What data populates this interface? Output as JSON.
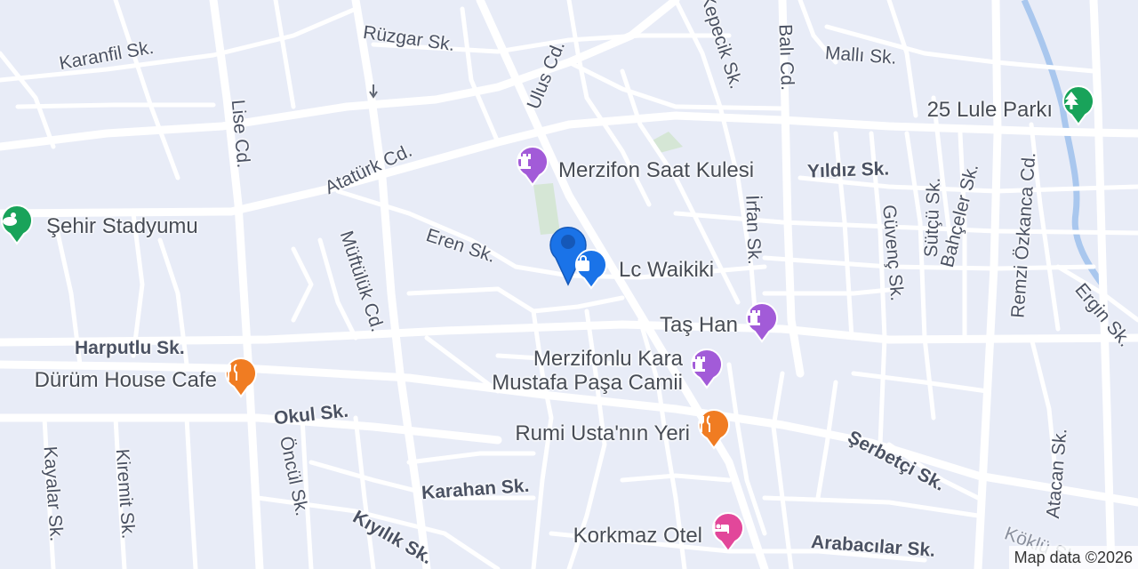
{
  "map": {
    "colors": {
      "background": "#e8ecf7",
      "road": "#ffffff",
      "park": "#d5e6d5",
      "water": "#a9c7ee",
      "landmark_pin": "#a25bd8",
      "restaurant_pin": "#f07c22",
      "shop_pin": "#1a73e8",
      "hotel_pin": "#e2479a",
      "park_pin": "#19a35a",
      "stadium_pin": "#19a35a",
      "location_marker": "#1a73e8"
    },
    "streets": {
      "karanfil": "Karanfil Sk.",
      "ruzgar": "Rüzgar Sk.",
      "ulus": "Ulus Cd.",
      "kepecik": "Kepecik Sk.",
      "bali": "Balı Cd.",
      "malli": "Mallı Sk.",
      "lise": "Lise Cd.",
      "ataturk": "Atatürk Cd.",
      "yildiz": "Yıldız Sk.",
      "irfan": "İrfan Sk.",
      "guvenc": "Güvenç Sk.",
      "sutcu": "Sütçü Sk.",
      "bahceler": "Bahçeler Sk.",
      "remzi": "Remzi Özkanca Cd.",
      "ergin": "Ergin Sk.",
      "eren": "Eren Sk.",
      "muftuluk": "Müftülük Cd.",
      "harputlu": "Harputlu Sk.",
      "okul": "Okul Sk.",
      "serbetci": "Şerbetçi Sk.",
      "atacan": "Atacan Sk.",
      "kayalar": "Kayalar Sk.",
      "kiremit": "Kiremit Sk.",
      "oncul": "Öncül Sk.",
      "karahan": "Karahan Sk.",
      "kiyilik": "Kıyılık Sk.",
      "arabacilar": "Arabacılar Sk.",
      "koklu": "Köklü Sk."
    },
    "pois": {
      "park": {
        "name": "25 Lule Parkı",
        "icon": "tree-icon"
      },
      "clock_tower": {
        "name": "Merzifon Saat Kulesi",
        "icon": "landmark-icon"
      },
      "stadium": {
        "name": "Şehir Stadyumu",
        "icon": "stadium-icon"
      },
      "lc_waikiki": {
        "name": "Lc Waikiki",
        "icon": "shopping-bag-icon"
      },
      "tas_han": {
        "name": "Taş Han",
        "icon": "landmark-icon"
      },
      "mosque": {
        "name_line1": "Merzifonlu Kara",
        "name_line2": "Mustafa Paşa Camii",
        "icon": "landmark-icon"
      },
      "durum_house": {
        "name": "Dürüm House Cafe",
        "icon": "restaurant-icon"
      },
      "rumi_usta": {
        "name": "Rumi Usta'nın Yeri",
        "icon": "restaurant-icon"
      },
      "korkmaz_otel": {
        "name": "Korkmaz Otel",
        "icon": "hotel-icon"
      }
    },
    "attribution": "Map data ©2026"
  }
}
